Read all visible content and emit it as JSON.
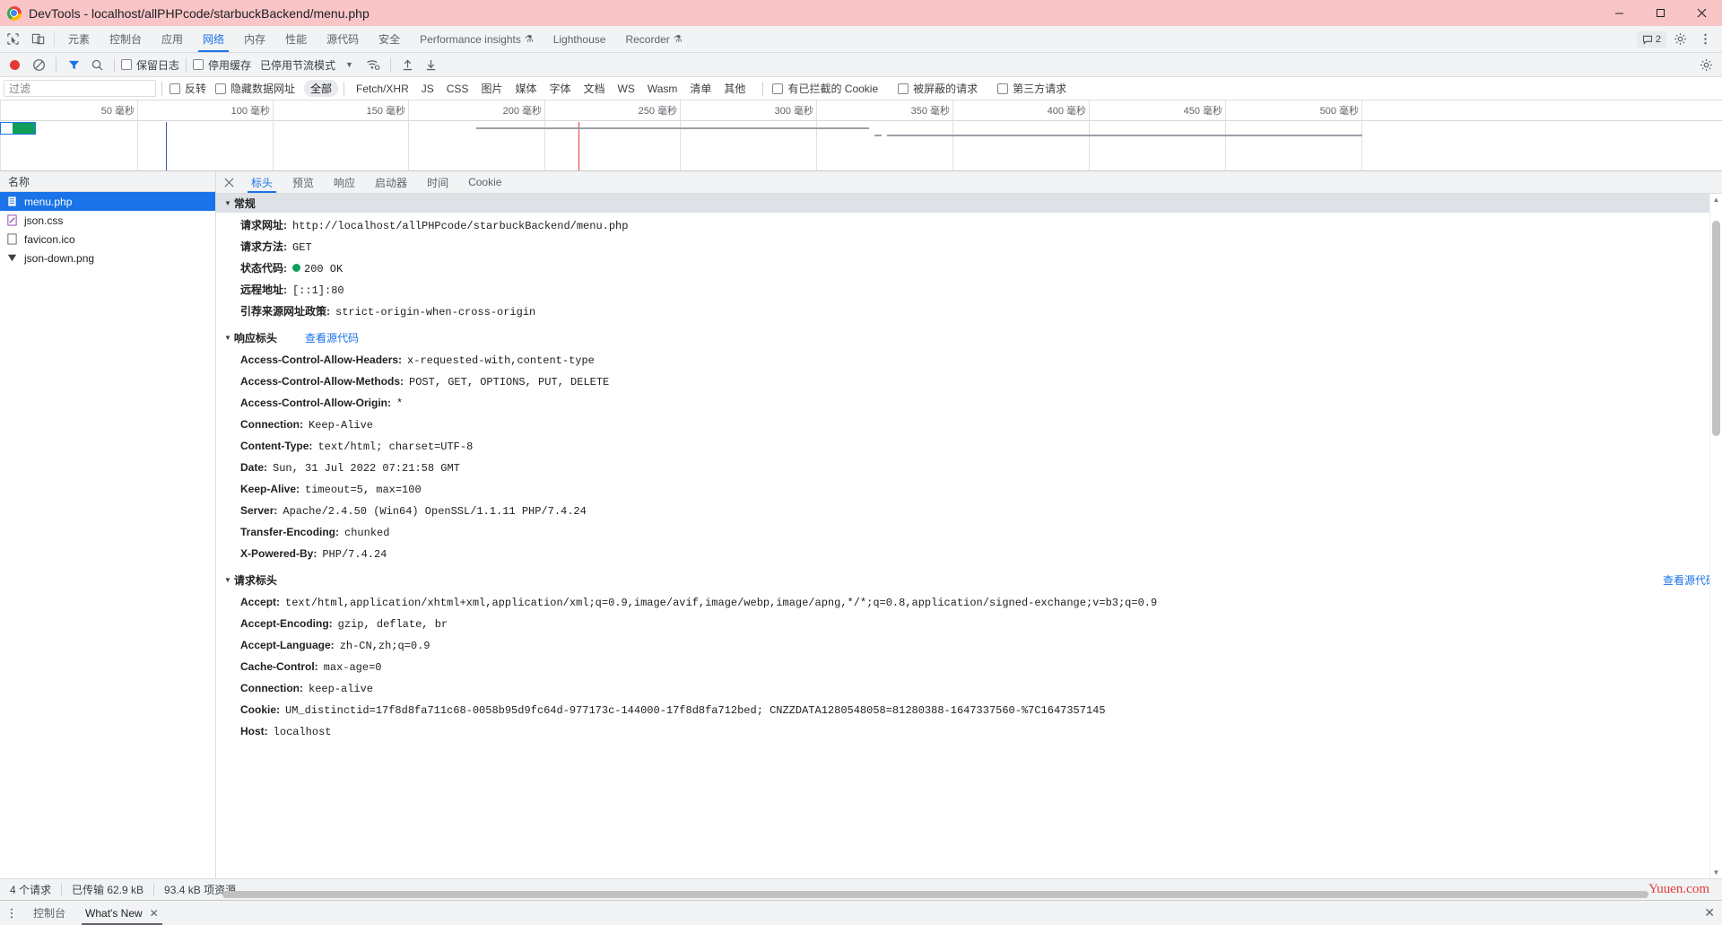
{
  "window": {
    "title": "DevTools - localhost/allPHPcode/starbuckBackend/menu.php",
    "minimize": "−",
    "maximize": "□",
    "close": "✕"
  },
  "main_tabs": {
    "inspect_icon": "inspect-cursor-icon",
    "device_icon": "device-toolbar-icon",
    "items": [
      {
        "label": "元素",
        "active": false,
        "beaker": ""
      },
      {
        "label": "控制台",
        "active": false,
        "beaker": ""
      },
      {
        "label": "应用",
        "active": false,
        "beaker": ""
      },
      {
        "label": "网络",
        "active": true,
        "beaker": ""
      },
      {
        "label": "内存",
        "active": false,
        "beaker": ""
      },
      {
        "label": "性能",
        "active": false,
        "beaker": ""
      },
      {
        "label": "源代码",
        "active": false,
        "beaker": ""
      },
      {
        "label": "安全",
        "active": false,
        "beaker": ""
      },
      {
        "label": "Performance insights",
        "active": false,
        "beaker": "⚗"
      },
      {
        "label": "Lighthouse",
        "active": false,
        "beaker": ""
      },
      {
        "label": "Recorder",
        "active": false,
        "beaker": "⚗"
      }
    ],
    "message_count": "2",
    "settings_icon": "gear-icon",
    "more_icon": "more-vertical-icon"
  },
  "network_toolbar": {
    "record_label": "record-button",
    "clear_label": "clear-button",
    "filter_label": "filter-toggle",
    "search_label": "search-button",
    "preserve_log": "保留日志",
    "disable_cache": "停用缓存",
    "throttling": "已停用节流模式",
    "wifi_icon": "network-conditions-icon",
    "import_icon": "import-har-icon",
    "export_icon": "export-har-icon",
    "settings_icon": "network-settings-icon"
  },
  "filter_row": {
    "placeholder": "过滤",
    "value": "",
    "invert": "反转",
    "hide_data_urls": "隐藏数据网址",
    "types": [
      {
        "label": "全部",
        "selected": true
      },
      {
        "label": "Fetch/XHR",
        "selected": false
      },
      {
        "label": "JS",
        "selected": false
      },
      {
        "label": "CSS",
        "selected": false
      },
      {
        "label": "图片",
        "selected": false
      },
      {
        "label": "媒体",
        "selected": false
      },
      {
        "label": "字体",
        "selected": false
      },
      {
        "label": "文档",
        "selected": false
      },
      {
        "label": "WS",
        "selected": false
      },
      {
        "label": "Wasm",
        "selected": false
      },
      {
        "label": "清单",
        "selected": false
      },
      {
        "label": "其他",
        "selected": false
      }
    ],
    "blocked_cookies": "有已拦截的 Cookie",
    "blocked_requests": "被屏蔽的请求",
    "third_party": "第三方请求"
  },
  "overview": {
    "ticks": [
      "50 毫秒",
      "100 毫秒",
      "150 毫秒",
      "200 毫秒",
      "250 毫秒",
      "300 毫秒",
      "350 毫秒",
      "400 毫秒",
      "450 毫秒",
      "500 毫秒"
    ]
  },
  "request_list": {
    "header": "名称",
    "rows": [
      {
        "name": "menu.php",
        "icon": "document-icon",
        "selected": true
      },
      {
        "name": "json.css",
        "icon": "stylesheet-icon",
        "selected": false
      },
      {
        "name": "favicon.ico",
        "icon": "generic-file-icon",
        "selected": false
      },
      {
        "name": "json-down.png",
        "icon": "image-icon",
        "selected": false
      }
    ]
  },
  "details": {
    "close": "✕",
    "tabs": [
      {
        "label": "标头",
        "active": true
      },
      {
        "label": "预览",
        "active": false
      },
      {
        "label": "响应",
        "active": false
      },
      {
        "label": "启动器",
        "active": false
      },
      {
        "label": "时间",
        "active": false
      },
      {
        "label": "Cookie",
        "active": false
      }
    ],
    "general": {
      "title": "常规",
      "rows": [
        {
          "key": "请求网址:",
          "value": "http://localhost/allPHPcode/starbuckBackend/menu.php",
          "dot": false
        },
        {
          "key": "请求方法:",
          "value": "GET",
          "dot": false
        },
        {
          "key": "状态代码:",
          "value": "200 OK",
          "dot": true
        },
        {
          "key": "远程地址:",
          "value": "[::1]:80",
          "dot": false
        },
        {
          "key": "引荐来源网址政策:",
          "value": "strict-origin-when-cross-origin",
          "dot": false
        }
      ]
    },
    "response_headers": {
      "title": "响应标头",
      "view_source": "查看源代码",
      "rows": [
        {
          "key": "Access-Control-Allow-Headers:",
          "value": "x-requested-with,content-type"
        },
        {
          "key": "Access-Control-Allow-Methods:",
          "value": "POST, GET, OPTIONS, PUT, DELETE"
        },
        {
          "key": "Access-Control-Allow-Origin:",
          "value": "*"
        },
        {
          "key": "Connection:",
          "value": "Keep-Alive"
        },
        {
          "key": "Content-Type:",
          "value": "text/html; charset=UTF-8"
        },
        {
          "key": "Date:",
          "value": "Sun, 31 Jul 2022 07:21:58 GMT"
        },
        {
          "key": "Keep-Alive:",
          "value": "timeout=5, max=100"
        },
        {
          "key": "Server:",
          "value": "Apache/2.4.50 (Win64) OpenSSL/1.1.11 PHP/7.4.24"
        },
        {
          "key": "Transfer-Encoding:",
          "value": "chunked"
        },
        {
          "key": "X-Powered-By:",
          "value": "PHP/7.4.24"
        }
      ]
    },
    "request_headers": {
      "title": "请求标头",
      "view_source": "查看源代码",
      "rows": [
        {
          "key": "Accept:",
          "value": "text/html,application/xhtml+xml,application/xml;q=0.9,image/avif,image/webp,image/apng,*/*;q=0.8,application/signed-exchange;v=b3;q=0.9"
        },
        {
          "key": "Accept-Encoding:",
          "value": "gzip, deflate, br"
        },
        {
          "key": "Accept-Language:",
          "value": "zh-CN,zh;q=0.9"
        },
        {
          "key": "Cache-Control:",
          "value": "max-age=0"
        },
        {
          "key": "Connection:",
          "value": "keep-alive"
        },
        {
          "key": "Cookie:",
          "value": "UM_distinctid=17f8d8fa711c68-0058b95d9fc64d-977173c-144000-17f8d8fa712bed; CNZZDATA1280548058=81280388-1647337560-%7C1647357145"
        },
        {
          "key": "Host:",
          "value": "localhost"
        }
      ]
    }
  },
  "statusbar": {
    "requests": "4 个请求",
    "transferred": "已传输 62.9 kB",
    "resources": "93.4 kB 项资源",
    "watermark": "Yuuen.com"
  },
  "drawer": {
    "more_icon": "more-vertical-icon",
    "tabs": [
      {
        "label": "控制台",
        "active": false
      },
      {
        "label": "What's New",
        "active": true
      }
    ],
    "tab_close": "✕",
    "close": "✕"
  },
  "colors": {
    "accent": "#1a73e8",
    "title_bg": "#f9c5c7",
    "status_ok": "#0f9d58",
    "record": "#e53935",
    "watermark": "#e53935"
  }
}
